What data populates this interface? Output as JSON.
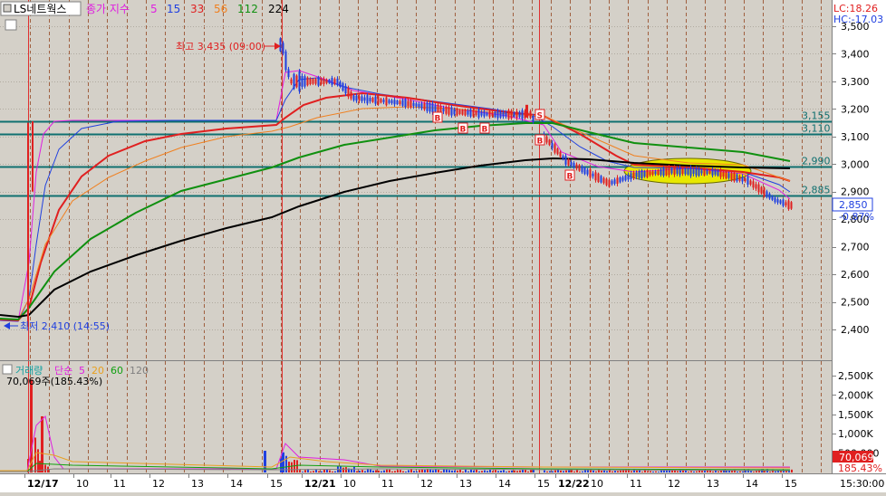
{
  "header": {
    "symbol_label": "LS네트웍스",
    "legend_title": "종가 지수",
    "ma_periods": [
      {
        "label": "5",
        "color": "#e020e0"
      },
      {
        "label": "15",
        "color": "#2040e0"
      },
      {
        "label": "33",
        "color": "#e02020"
      },
      {
        "label": "56",
        "color": "#f08020"
      },
      {
        "label": "112",
        "color": "#109010"
      },
      {
        "label": "224",
        "color": "#000000"
      }
    ],
    "lc_text": "LC:18.26",
    "hc_text": "HC:-17.03"
  },
  "annotations": {
    "high_text": "최고 3,435 (09:00)",
    "low_text": "최저 2,410 (14:55)"
  },
  "price_axis": {
    "ticks": [
      "3,500",
      "3,400",
      "3,300",
      "3,200",
      "3,100",
      "3,000",
      "2,900",
      "2,800",
      "2,700",
      "2,600",
      "2,500",
      "2,400"
    ],
    "current_price": "2,850",
    "current_change": "-0.87%"
  },
  "hlines": [
    {
      "label": "3,155",
      "value": 3155
    },
    {
      "label": "3,110",
      "value": 3110
    },
    {
      "label": "2,990",
      "value": 2990
    },
    {
      "label": "2,885",
      "value": 2885
    }
  ],
  "volume_panel": {
    "title": "거래량",
    "sub_title": "단순",
    "periods": [
      {
        "label": "5",
        "color": "#e020e0"
      },
      {
        "label": "20",
        "color": "#e8a020"
      },
      {
        "label": "60",
        "color": "#10a010"
      },
      {
        "label": "120",
        "color": "#808080"
      }
    ],
    "info_text": "70,069주(185.43%)",
    "axis_ticks": [
      "2,500K",
      "2,000K",
      "1,500K",
      "1,000K",
      "500,000"
    ],
    "current_volume": "70,069",
    "current_ratio": "185.43%"
  },
  "time_axis": {
    "ticks": [
      {
        "label": "12/17",
        "bold": true
      },
      {
        "label": "10"
      },
      {
        "label": "11"
      },
      {
        "label": "12"
      },
      {
        "label": "13"
      },
      {
        "label": "14"
      },
      {
        "label": "15"
      },
      {
        "label": "12/21",
        "bold": true
      },
      {
        "label": "10"
      },
      {
        "label": "11"
      },
      {
        "label": "12"
      },
      {
        "label": "13"
      },
      {
        "label": "14"
      },
      {
        "label": "15"
      },
      {
        "label": "12/22",
        "bold": true
      },
      {
        "label": "10"
      },
      {
        "label": "11"
      },
      {
        "label": "12"
      },
      {
        "label": "13"
      },
      {
        "label": "14"
      },
      {
        "label": "15"
      }
    ],
    "end_time": "15:30:00"
  },
  "chart_data": {
    "type": "candlestick",
    "title": "LS네트웍스",
    "sessions": [
      "12/17",
      "12/21",
      "12/22"
    ],
    "price_range": [
      2330,
      3520
    ],
    "volume_range_k": [
      0,
      2700
    ],
    "candles_close": [
      {
        "t": "12/17 09:00",
        "v": 2410
      },
      {
        "t": "12/17 09:05",
        "v": 3140
      },
      {
        "t": "12/17 15:30",
        "v": 3150
      },
      {
        "t": "12/21 09:00",
        "v": 3435
      },
      {
        "t": "12/21 09:30",
        "v": 3300
      },
      {
        "t": "12/21 10:20",
        "v": 3300
      },
      {
        "t": "12/21 10:40",
        "v": 3240
      },
      {
        "t": "12/21 12:00",
        "v": 3220
      },
      {
        "t": "12/21 13:00",
        "v": 3190
      },
      {
        "t": "12/21 14:00",
        "v": 3180
      },
      {
        "t": "12/21 15:00",
        "v": 3180
      },
      {
        "t": "12/22 09:00",
        "v": 3100
      },
      {
        "t": "12/22 09:30",
        "v": 3010
      },
      {
        "t": "12/22 10:30",
        "v": 2930
      },
      {
        "t": "12/22 11:00",
        "v": 2960
      },
      {
        "t": "12/22 12:00",
        "v": 2975
      },
      {
        "t": "12/22 13:00",
        "v": 2970
      },
      {
        "t": "12/22 14:00",
        "v": 2940
      },
      {
        "t": "12/22 14:40",
        "v": 2870
      },
      {
        "t": "12/22 15:00",
        "v": 2850
      }
    ],
    "moving_averages": [
      {
        "name": "5",
        "color": "#e020e0"
      },
      {
        "name": "15",
        "color": "#2040e0"
      },
      {
        "name": "33",
        "color": "#e02020"
      },
      {
        "name": "56",
        "color": "#f08020"
      },
      {
        "name": "112",
        "color": "#109010"
      },
      {
        "name": "224",
        "color": "#000000"
      }
    ],
    "volume_spikes_k": [
      {
        "t": "12/17 09:00",
        "v": 2400
      },
      {
        "t": "12/17 09:05",
        "v": 1450
      },
      {
        "t": "12/21 09:00",
        "v": 500
      }
    ],
    "signals": [
      "B",
      "B",
      "B",
      "S",
      "B",
      "B"
    ]
  }
}
